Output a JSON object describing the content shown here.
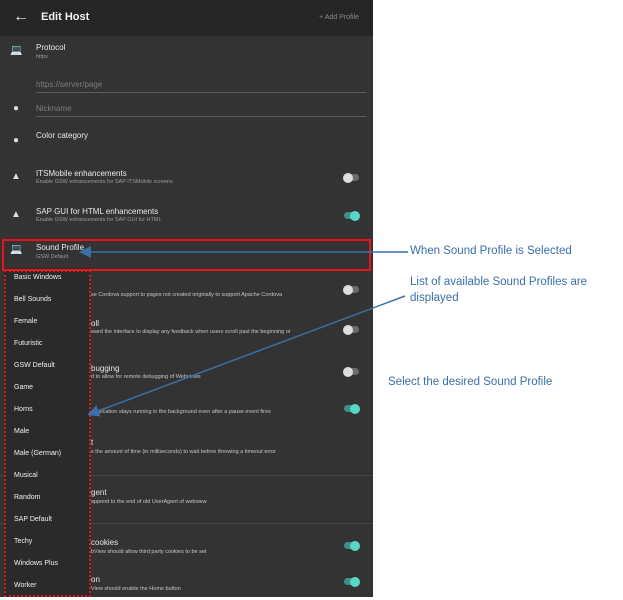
{
  "appbar": {
    "back_icon": "arrow-left-icon",
    "title": "Edit Host",
    "action": "+ Add Profile"
  },
  "settings": {
    "protocol": {
      "label": "Protocol",
      "value": "https",
      "icon": "laptop-icon"
    },
    "url": {
      "placeholder": "https://server/page"
    },
    "nickname": {
      "placeholder": "Nickname",
      "icon": "person-icon"
    },
    "color": {
      "label": "Color category",
      "icon": "palette-icon"
    },
    "itsmobile": {
      "label": "ITSMobile enhancements",
      "desc": "Enable GSW enhancements for SAP ITSMobile screens",
      "icon": "android-icon",
      "toggle": "off"
    },
    "sapgui": {
      "label": "SAP GUI for HTML enhancements",
      "desc": "Enable GSW enhancements for SAP GUI for HTML",
      "icon": "android-icon",
      "toggle": "on"
    },
    "sound": {
      "label": "Sound Profile",
      "value": "GSW Default",
      "icon": "laptop-icon"
    }
  },
  "partial": {
    "cordova_desc": "se Cordova support to pages not created originally to support Apache Cordova",
    "scroll_title": "oll",
    "scroll_desc": "ward the interface to display any feedback when users scroll past the beginning or",
    "debug_title": "bugging",
    "debug_desc": "d to allow for remote debugging of Webviews",
    "bg_desc": "application stays running in the background even after a pause event fires",
    "timeout_title": "t",
    "timeout_desc": "s the amount of time (in milliseconds) to wait before throwing a timeout error",
    "agent_title": "gent",
    "agent_desc": "append to the end of old UserAgent of webview",
    "cookies_title": "cookies",
    "cookies_desc": "bView should allow third party cookies to be set",
    "home_title": "on",
    "home_desc": "View should enable the Home button"
  },
  "dropdown": {
    "options": [
      "Basic Windows",
      "Bell Sounds",
      "Female",
      "Futuristic",
      "GSW Default",
      "Game",
      "Horns",
      "Male",
      "Male (German)",
      "Musical",
      "Random",
      "SAP Default",
      "Techy",
      "Windows Plus",
      "Worker"
    ]
  },
  "annotations": {
    "selected": "When Sound Profile is Selected",
    "list_line1": "List of available Sound Profiles are",
    "list_line2": "displayed",
    "select": "Select the desired Sound Profile"
  },
  "colors": {
    "background": "#333333",
    "appbar": "#262626",
    "accent": "#5ad6c6",
    "highlight": "#e8141c",
    "annotation": "#3a6fa8"
  }
}
